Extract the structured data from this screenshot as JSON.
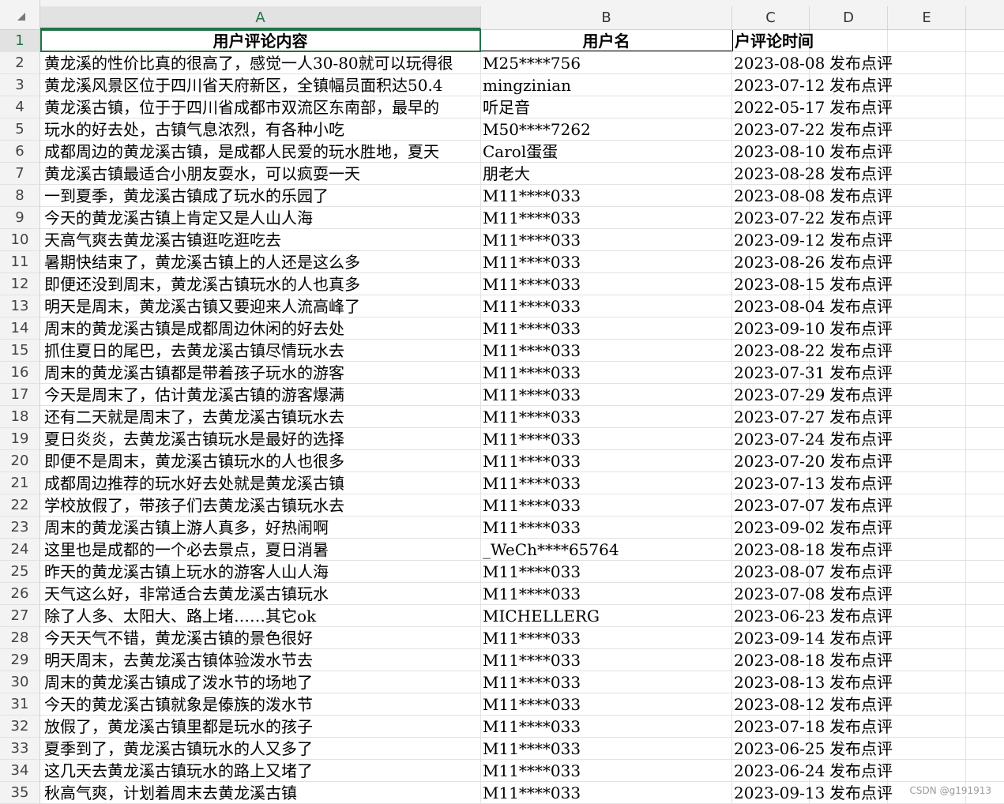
{
  "columns": [
    "A",
    "B",
    "C",
    "D",
    "E"
  ],
  "selected_column": "A",
  "header_row": {
    "A": "用户评论内容",
    "B": "用户名",
    "C": "户评论时间"
  },
  "rows": [
    {
      "n": "2",
      "a": "黄龙溪的性价比真的很高了，感觉一人30-80就可以玩得很",
      "b": "M25****756",
      "date": "2023-08-08",
      "action": "发布点评"
    },
    {
      "n": "3",
      "a": "黄龙溪风景区位于四川省天府新区，全镇幅员面积达50.4",
      "b": "mingzinian",
      "date": "2023-07-12",
      "action": "发布点评"
    },
    {
      "n": "4",
      "a": "黄龙溪古镇，位于于四川省成都市双流区东南部，最早的",
      "b": "听足音",
      "date": "2022-05-17",
      "action": "发布点评"
    },
    {
      "n": "5",
      "a": "玩水的好去处，古镇气息浓烈，有各种小吃",
      "b": "M50****7262",
      "date": "2023-07-22",
      "action": "发布点评"
    },
    {
      "n": "6",
      "a": "成都周边的黄龙溪古镇，是成都人民爱的玩水胜地，夏天",
      "b": "Carol蛋蛋",
      "date": "2023-08-10",
      "action": "发布点评"
    },
    {
      "n": "7",
      "a": "黄龙溪古镇最适合小朋友耍水，可以疯耍一天",
      "b": "朋老大",
      "date": "2023-08-28",
      "action": "发布点评"
    },
    {
      "n": "8",
      "a": "一到夏季，黄龙溪古镇成了玩水的乐园了",
      "b": "M11****033",
      "date": "2023-08-08",
      "action": "发布点评"
    },
    {
      "n": "9",
      "a": "今天的黄龙溪古镇上肯定又是人山人海",
      "b": "M11****033",
      "date": "2023-07-22",
      "action": "发布点评"
    },
    {
      "n": "10",
      "a": "天高气爽去黄龙溪古镇逛吃逛吃去",
      "b": "M11****033",
      "date": "2023-09-12",
      "action": "发布点评"
    },
    {
      "n": "11",
      "a": "暑期快结束了，黄龙溪古镇上的人还是这么多",
      "b": "M11****033",
      "date": "2023-08-26",
      "action": "发布点评"
    },
    {
      "n": "12",
      "a": "即便还没到周末，黄龙溪古镇玩水的人也真多",
      "b": "M11****033",
      "date": "2023-08-15",
      "action": "发布点评"
    },
    {
      "n": "13",
      "a": "明天是周末，黄龙溪古镇又要迎来人流高峰了",
      "b": "M11****033",
      "date": "2023-08-04",
      "action": "发布点评"
    },
    {
      "n": "14",
      "a": "周末的黄龙溪古镇是成都周边休闲的好去处",
      "b": "M11****033",
      "date": "2023-09-10",
      "action": "发布点评"
    },
    {
      "n": "15",
      "a": "抓住夏日的尾巴，去黄龙溪古镇尽情玩水去",
      "b": "M11****033",
      "date": "2023-08-22",
      "action": "发布点评"
    },
    {
      "n": "16",
      "a": "周末的黄龙溪古镇都是带着孩子玩水的游客",
      "b": "M11****033",
      "date": "2023-07-31",
      "action": "发布点评"
    },
    {
      "n": "17",
      "a": "今天是周末了，估计黄龙溪古镇的游客爆满",
      "b": "M11****033",
      "date": "2023-07-29",
      "action": "发布点评"
    },
    {
      "n": "18",
      "a": "还有二天就是周末了，去黄龙溪古镇玩水去",
      "b": "M11****033",
      "date": "2023-07-27",
      "action": "发布点评"
    },
    {
      "n": "19",
      "a": "夏日炎炎，去黄龙溪古镇玩水是最好的选择",
      "b": "M11****033",
      "date": "2023-07-24",
      "action": "发布点评"
    },
    {
      "n": "20",
      "a": "即便不是周末，黄龙溪古镇玩水的人也很多",
      "b": "M11****033",
      "date": "2023-07-20",
      "action": "发布点评"
    },
    {
      "n": "21",
      "a": "成都周边推荐的玩水好去处就是黄龙溪古镇",
      "b": "M11****033",
      "date": "2023-07-13",
      "action": "发布点评"
    },
    {
      "n": "22",
      "a": "学校放假了，带孩子们去黄龙溪古镇玩水去",
      "b": "M11****033",
      "date": "2023-07-07",
      "action": "发布点评"
    },
    {
      "n": "23",
      "a": "周末的黄龙溪古镇上游人真多，好热闹啊",
      "b": "M11****033",
      "date": "2023-09-02",
      "action": "发布点评"
    },
    {
      "n": "24",
      "a": "这里也是成都的一个必去景点，夏日消暑",
      "b": "_WeCh****65764",
      "date": "2023-08-18",
      "action": "发布点评"
    },
    {
      "n": "25",
      "a": "昨天的黄龙溪古镇上玩水的游客人山人海",
      "b": "M11****033",
      "date": "2023-08-07",
      "action": "发布点评"
    },
    {
      "n": "26",
      "a": "天气这么好，非常适合去黄龙溪古镇玩水",
      "b": "M11****033",
      "date": "2023-07-08",
      "action": "发布点评"
    },
    {
      "n": "27",
      "a": "除了人多、太阳大、路上堵……其它ok",
      "b": "MICHELLERG",
      "date": "2023-06-23",
      "action": "发布点评"
    },
    {
      "n": "28",
      "a": "今天天气不错，黄龙溪古镇的景色很好",
      "b": "M11****033",
      "date": "2023-09-14",
      "action": "发布点评"
    },
    {
      "n": "29",
      "a": "明天周末，去黄龙溪古镇体验泼水节去",
      "b": "M11****033",
      "date": "2023-08-18",
      "action": "发布点评"
    },
    {
      "n": "30",
      "a": "周末的黄龙溪古镇成了泼水节的场地了",
      "b": "M11****033",
      "date": "2023-08-13",
      "action": "发布点评"
    },
    {
      "n": "31",
      "a": "今天的黄龙溪古镇就象是傣族的泼水节",
      "b": "M11****033",
      "date": "2023-08-12",
      "action": "发布点评"
    },
    {
      "n": "32",
      "a": "放假了，黄龙溪古镇里都是玩水的孩子",
      "b": "M11****033",
      "date": "2023-07-18",
      "action": "发布点评"
    },
    {
      "n": "33",
      "a": "夏季到了，黄龙溪古镇玩水的人又多了",
      "b": "M11****033",
      "date": "2023-06-25",
      "action": "发布点评"
    },
    {
      "n": "34",
      "a": "这几天去黄龙溪古镇玩水的路上又堵了",
      "b": "M11****033",
      "date": "2023-06-24",
      "action": "发布点评"
    },
    {
      "n": "35",
      "a": "秋高气爽，计划着周末去黄龙溪古镇",
      "b": "M11****033",
      "date": "2023-09-13",
      "action": "发布点评"
    }
  ],
  "watermark": "CSDN @g191913"
}
